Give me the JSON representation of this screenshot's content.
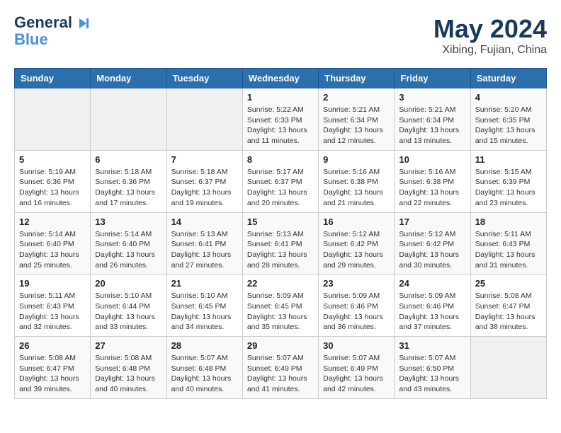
{
  "header": {
    "logo_line1": "General",
    "logo_line2": "Blue",
    "month_year": "May 2024",
    "location": "Xibing, Fujian, China"
  },
  "days_of_week": [
    "Sunday",
    "Monday",
    "Tuesday",
    "Wednesday",
    "Thursday",
    "Friday",
    "Saturday"
  ],
  "weeks": [
    [
      {
        "day": "",
        "sunrise": "",
        "sunset": "",
        "daylight": ""
      },
      {
        "day": "",
        "sunrise": "",
        "sunset": "",
        "daylight": ""
      },
      {
        "day": "",
        "sunrise": "",
        "sunset": "",
        "daylight": ""
      },
      {
        "day": "1",
        "sunrise": "Sunrise: 5:22 AM",
        "sunset": "Sunset: 6:33 PM",
        "daylight": "Daylight: 13 hours and 11 minutes."
      },
      {
        "day": "2",
        "sunrise": "Sunrise: 5:21 AM",
        "sunset": "Sunset: 6:34 PM",
        "daylight": "Daylight: 13 hours and 12 minutes."
      },
      {
        "day": "3",
        "sunrise": "Sunrise: 5:21 AM",
        "sunset": "Sunset: 6:34 PM",
        "daylight": "Daylight: 13 hours and 13 minutes."
      },
      {
        "day": "4",
        "sunrise": "Sunrise: 5:20 AM",
        "sunset": "Sunset: 6:35 PM",
        "daylight": "Daylight: 13 hours and 15 minutes."
      }
    ],
    [
      {
        "day": "5",
        "sunrise": "Sunrise: 5:19 AM",
        "sunset": "Sunset: 6:36 PM",
        "daylight": "Daylight: 13 hours and 16 minutes."
      },
      {
        "day": "6",
        "sunrise": "Sunrise: 5:18 AM",
        "sunset": "Sunset: 6:36 PM",
        "daylight": "Daylight: 13 hours and 17 minutes."
      },
      {
        "day": "7",
        "sunrise": "Sunrise: 5:18 AM",
        "sunset": "Sunset: 6:37 PM",
        "daylight": "Daylight: 13 hours and 19 minutes."
      },
      {
        "day": "8",
        "sunrise": "Sunrise: 5:17 AM",
        "sunset": "Sunset: 6:37 PM",
        "daylight": "Daylight: 13 hours and 20 minutes."
      },
      {
        "day": "9",
        "sunrise": "Sunrise: 5:16 AM",
        "sunset": "Sunset: 6:38 PM",
        "daylight": "Daylight: 13 hours and 21 minutes."
      },
      {
        "day": "10",
        "sunrise": "Sunrise: 5:16 AM",
        "sunset": "Sunset: 6:38 PM",
        "daylight": "Daylight: 13 hours and 22 minutes."
      },
      {
        "day": "11",
        "sunrise": "Sunrise: 5:15 AM",
        "sunset": "Sunset: 6:39 PM",
        "daylight": "Daylight: 13 hours and 23 minutes."
      }
    ],
    [
      {
        "day": "12",
        "sunrise": "Sunrise: 5:14 AM",
        "sunset": "Sunset: 6:40 PM",
        "daylight": "Daylight: 13 hours and 25 minutes."
      },
      {
        "day": "13",
        "sunrise": "Sunrise: 5:14 AM",
        "sunset": "Sunset: 6:40 PM",
        "daylight": "Daylight: 13 hours and 26 minutes."
      },
      {
        "day": "14",
        "sunrise": "Sunrise: 5:13 AM",
        "sunset": "Sunset: 6:41 PM",
        "daylight": "Daylight: 13 hours and 27 minutes."
      },
      {
        "day": "15",
        "sunrise": "Sunrise: 5:13 AM",
        "sunset": "Sunset: 6:41 PM",
        "daylight": "Daylight: 13 hours and 28 minutes."
      },
      {
        "day": "16",
        "sunrise": "Sunrise: 5:12 AM",
        "sunset": "Sunset: 6:42 PM",
        "daylight": "Daylight: 13 hours and 29 minutes."
      },
      {
        "day": "17",
        "sunrise": "Sunrise: 5:12 AM",
        "sunset": "Sunset: 6:42 PM",
        "daylight": "Daylight: 13 hours and 30 minutes."
      },
      {
        "day": "18",
        "sunrise": "Sunrise: 5:11 AM",
        "sunset": "Sunset: 6:43 PM",
        "daylight": "Daylight: 13 hours and 31 minutes."
      }
    ],
    [
      {
        "day": "19",
        "sunrise": "Sunrise: 5:11 AM",
        "sunset": "Sunset: 6:43 PM",
        "daylight": "Daylight: 13 hours and 32 minutes."
      },
      {
        "day": "20",
        "sunrise": "Sunrise: 5:10 AM",
        "sunset": "Sunset: 6:44 PM",
        "daylight": "Daylight: 13 hours and 33 minutes."
      },
      {
        "day": "21",
        "sunrise": "Sunrise: 5:10 AM",
        "sunset": "Sunset: 6:45 PM",
        "daylight": "Daylight: 13 hours and 34 minutes."
      },
      {
        "day": "22",
        "sunrise": "Sunrise: 5:09 AM",
        "sunset": "Sunset: 6:45 PM",
        "daylight": "Daylight: 13 hours and 35 minutes."
      },
      {
        "day": "23",
        "sunrise": "Sunrise: 5:09 AM",
        "sunset": "Sunset: 6:46 PM",
        "daylight": "Daylight: 13 hours and 36 minutes."
      },
      {
        "day": "24",
        "sunrise": "Sunrise: 5:09 AM",
        "sunset": "Sunset: 6:46 PM",
        "daylight": "Daylight: 13 hours and 37 minutes."
      },
      {
        "day": "25",
        "sunrise": "Sunrise: 5:08 AM",
        "sunset": "Sunset: 6:47 PM",
        "daylight": "Daylight: 13 hours and 38 minutes."
      }
    ],
    [
      {
        "day": "26",
        "sunrise": "Sunrise: 5:08 AM",
        "sunset": "Sunset: 6:47 PM",
        "daylight": "Daylight: 13 hours and 39 minutes."
      },
      {
        "day": "27",
        "sunrise": "Sunrise: 5:08 AM",
        "sunset": "Sunset: 6:48 PM",
        "daylight": "Daylight: 13 hours and 40 minutes."
      },
      {
        "day": "28",
        "sunrise": "Sunrise: 5:07 AM",
        "sunset": "Sunset: 6:48 PM",
        "daylight": "Daylight: 13 hours and 40 minutes."
      },
      {
        "day": "29",
        "sunrise": "Sunrise: 5:07 AM",
        "sunset": "Sunset: 6:49 PM",
        "daylight": "Daylight: 13 hours and 41 minutes."
      },
      {
        "day": "30",
        "sunrise": "Sunrise: 5:07 AM",
        "sunset": "Sunset: 6:49 PM",
        "daylight": "Daylight: 13 hours and 42 minutes."
      },
      {
        "day": "31",
        "sunrise": "Sunrise: 5:07 AM",
        "sunset": "Sunset: 6:50 PM",
        "daylight": "Daylight: 13 hours and 43 minutes."
      },
      {
        "day": "",
        "sunrise": "",
        "sunset": "",
        "daylight": ""
      }
    ]
  ]
}
